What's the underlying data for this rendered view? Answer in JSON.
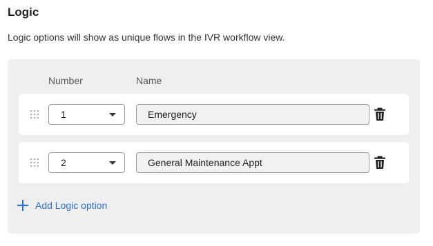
{
  "section": {
    "title": "Logic",
    "description": "Logic options will show as unique flows in the IVR workflow view."
  },
  "table": {
    "headers": {
      "number": "Number",
      "name": "Name"
    },
    "rows": [
      {
        "number": "1",
        "name": "Emergency"
      },
      {
        "number": "2",
        "name": "General Maintenance Appt"
      }
    ]
  },
  "actions": {
    "add_label": "Add Logic option"
  },
  "icons": {
    "drag": "drag-handle-icon",
    "dropdown": "chevron-down-icon",
    "delete": "trash-icon",
    "add": "plus-icon"
  },
  "colors": {
    "accent": "#2b6fd6",
    "panel": "#efefef"
  }
}
